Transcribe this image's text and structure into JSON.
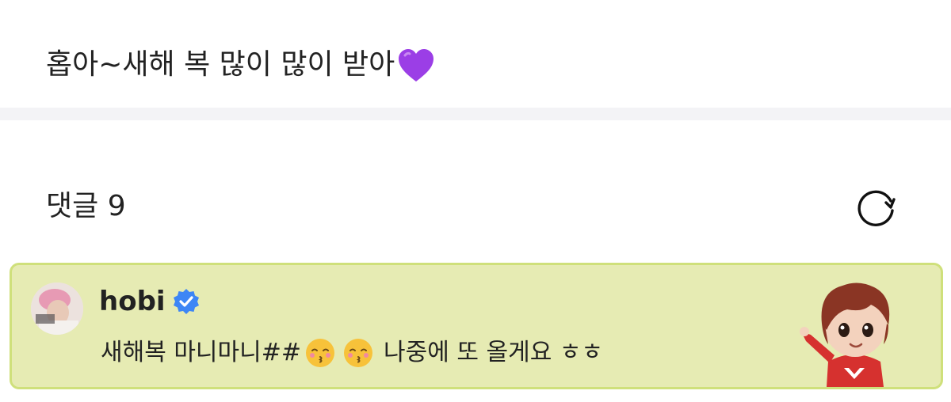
{
  "post": {
    "text": "홉아~새해 복 많이 많이 받아",
    "emoji": "purple-heart"
  },
  "comments": {
    "header_label": "댓글",
    "count": "9",
    "refresh_icon": "refresh-icon"
  },
  "comment": {
    "author": "hobi",
    "verified": true,
    "text_before": "새해복 마니마니##",
    "emojis": [
      "kissing-face-with-closed-eyes",
      "kissing-face-with-closed-eyes"
    ],
    "text_after": "나중에 또 올게요 ㅎㅎ"
  },
  "colors": {
    "comment_bg": "#e6ebb3",
    "comment_border": "#cfe07b",
    "verified_blue": "#3d86f5",
    "heart_purple": "#9b3ee6",
    "divider": "#f3f3f6"
  }
}
